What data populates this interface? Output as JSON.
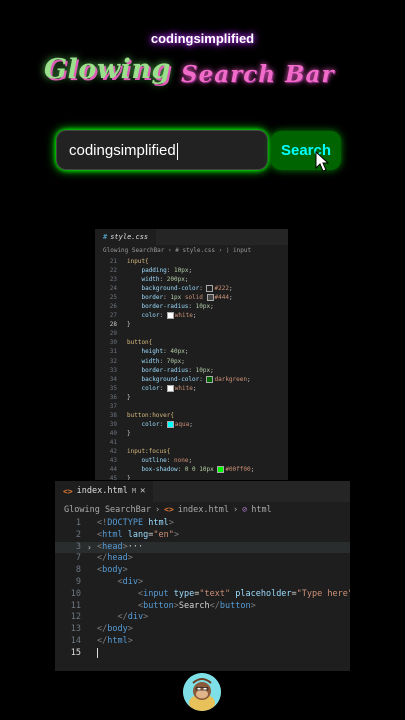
{
  "header": {
    "channel": "codingsimplified",
    "title_part1": "Glowing",
    "title_part2": "Search Bar"
  },
  "demo": {
    "input_value": "codingsimplified",
    "button_label": "Search"
  },
  "css_editor": {
    "tab": "style.css",
    "breadcrumb": "Glowing SearchBar › # style.css › ⟩ input",
    "lines": [
      {
        "n": "21",
        "segs": [
          [
            "input{",
            "sel"
          ]
        ]
      },
      {
        "n": "22",
        "segs": [
          [
            "    ",
            ""
          ],
          [
            "padding",
            "prop"
          ],
          [
            ": ",
            "punc"
          ],
          [
            "10px",
            "num"
          ],
          [
            ";",
            "punc"
          ]
        ]
      },
      {
        "n": "23",
        "segs": [
          [
            "    ",
            ""
          ],
          [
            "width",
            "prop"
          ],
          [
            ": ",
            "punc"
          ],
          [
            "200px",
            "num"
          ],
          [
            ";",
            "punc"
          ]
        ]
      },
      {
        "n": "24",
        "segs": [
          [
            "    ",
            ""
          ],
          [
            "background-color",
            "prop"
          ],
          [
            ": ",
            "punc"
          ],
          [
            "sw:#222",
            ""
          ],
          [
            "#222",
            "val"
          ],
          [
            ";",
            "punc"
          ]
        ]
      },
      {
        "n": "25",
        "segs": [
          [
            "    ",
            ""
          ],
          [
            "border",
            "prop"
          ],
          [
            ": ",
            "punc"
          ],
          [
            "1px ",
            "num"
          ],
          [
            "solid ",
            "val"
          ],
          [
            "sw:#444",
            ""
          ],
          [
            "#444",
            "val"
          ],
          [
            ";",
            "punc"
          ]
        ]
      },
      {
        "n": "26",
        "segs": [
          [
            "    ",
            ""
          ],
          [
            "border-radius",
            "prop"
          ],
          [
            ": ",
            "punc"
          ],
          [
            "10px",
            "num"
          ],
          [
            ";",
            "punc"
          ]
        ]
      },
      {
        "n": "27",
        "segs": [
          [
            "    ",
            ""
          ],
          [
            "color",
            "prop"
          ],
          [
            ": ",
            "punc"
          ],
          [
            "sw:#ffffff",
            ""
          ],
          [
            "white",
            "val"
          ],
          [
            ";",
            "punc"
          ]
        ]
      },
      {
        "n": "28",
        "segs": [
          [
            "}",
            "punc"
          ]
        ]
      },
      {
        "n": "29",
        "segs": []
      },
      {
        "n": "30",
        "segs": [
          [
            "button{",
            "sel"
          ]
        ]
      },
      {
        "n": "31",
        "segs": [
          [
            "    ",
            ""
          ],
          [
            "height",
            "prop"
          ],
          [
            ": ",
            "punc"
          ],
          [
            "40px",
            "num"
          ],
          [
            ";",
            "punc"
          ]
        ]
      },
      {
        "n": "32",
        "segs": [
          [
            "    ",
            ""
          ],
          [
            "width",
            "prop"
          ],
          [
            ": ",
            "punc"
          ],
          [
            "70px",
            "num"
          ],
          [
            ";",
            "punc"
          ]
        ]
      },
      {
        "n": "33",
        "segs": [
          [
            "    ",
            ""
          ],
          [
            "border-radius",
            "prop"
          ],
          [
            ": ",
            "punc"
          ],
          [
            "10px",
            "num"
          ],
          [
            ";",
            "punc"
          ]
        ]
      },
      {
        "n": "34",
        "segs": [
          [
            "    ",
            ""
          ],
          [
            "background-color",
            "prop"
          ],
          [
            ": ",
            "punc"
          ],
          [
            "sw:#006400",
            ""
          ],
          [
            "darkgreen",
            "val"
          ],
          [
            ";",
            "punc"
          ]
        ]
      },
      {
        "n": "35",
        "segs": [
          [
            "    ",
            ""
          ],
          [
            "color",
            "prop"
          ],
          [
            ": ",
            "punc"
          ],
          [
            "sw:#ffffff",
            ""
          ],
          [
            "white",
            "val"
          ],
          [
            ";",
            "punc"
          ]
        ]
      },
      {
        "n": "36",
        "segs": [
          [
            "}",
            "punc"
          ]
        ]
      },
      {
        "n": "37",
        "segs": []
      },
      {
        "n": "38",
        "segs": [
          [
            "button:hover{",
            "sel"
          ]
        ]
      },
      {
        "n": "39",
        "segs": [
          [
            "    ",
            ""
          ],
          [
            "color",
            "prop"
          ],
          [
            ": ",
            "punc"
          ],
          [
            "sw:#00ffff",
            ""
          ],
          [
            "aqua",
            "val"
          ],
          [
            ";",
            "punc"
          ]
        ]
      },
      {
        "n": "40",
        "segs": [
          [
            "}",
            "punc"
          ]
        ]
      },
      {
        "n": "41",
        "segs": []
      },
      {
        "n": "42",
        "segs": [
          [
            "input:focus{",
            "sel"
          ]
        ]
      },
      {
        "n": "43",
        "segs": [
          [
            "    ",
            ""
          ],
          [
            "outline",
            "prop"
          ],
          [
            ": ",
            "punc"
          ],
          [
            "none",
            "val"
          ],
          [
            ";",
            "punc"
          ]
        ]
      },
      {
        "n": "44",
        "segs": [
          [
            "    ",
            ""
          ],
          [
            "box-shadow",
            "prop"
          ],
          [
            ": ",
            "punc"
          ],
          [
            "0 0 10px ",
            "num"
          ],
          [
            "sw:#00ff00",
            ""
          ],
          [
            "#00ff00",
            "val"
          ],
          [
            ";",
            "punc"
          ]
        ]
      },
      {
        "n": "45",
        "segs": [
          [
            "}",
            "punc"
          ]
        ]
      },
      {
        "n": "46",
        "segs": []
      }
    ],
    "active_line": "28"
  },
  "html_editor": {
    "tab": "index.html",
    "tab_badge": "M",
    "breadcrumb_root": "Glowing SearchBar",
    "breadcrumb_file": "index.html",
    "breadcrumb_node": "html",
    "lines": [
      {
        "n": "1",
        "html": "<span class='br'>&lt;!</span><span class='tag'>DOCTYPE</span> <span class='attr'>html</span><span class='br'>&gt;</span>"
      },
      {
        "n": "2",
        "html": "<span class='br'>&lt;</span><span class='tag'>html</span> <span class='attr'>lang</span><span class='txt'>=</span><span class='str'>\"en\"</span><span class='br'>&gt;</span>"
      },
      {
        "n": "3",
        "html": "<span class='br'>&lt;</span><span class='tag'>head</span><span class='br'>&gt;</span><span class='txt'>···</span>",
        "fold": true,
        "hl": true
      },
      {
        "n": "7",
        "html": "<span class='br'>&lt;/</span><span class='tag'>head</span><span class='br'>&gt;</span>"
      },
      {
        "n": "8",
        "html": "<span class='br'>&lt;</span><span class='tag'>body</span><span class='br'>&gt;</span>"
      },
      {
        "n": "9",
        "html": "    <span class='br'>&lt;</span><span class='tag'>div</span><span class='br'>&gt;</span>"
      },
      {
        "n": "10",
        "html": "        <span class='br'>&lt;</span><span class='tag'>input</span> <span class='attr'>type</span><span class='txt'>=</span><span class='str'>\"text\"</span> <span class='attr'>placeholder</span><span class='txt'>=</span><span class='str'>\"Type here\"</span><span class='br'>&gt;</span>"
      },
      {
        "n": "11",
        "html": "        <span class='br'>&lt;</span><span class='tag'>button</span><span class='br'>&gt;</span><span class='txt'>Search</span><span class='br'>&lt;/</span><span class='tag'>button</span><span class='br'>&gt;</span>"
      },
      {
        "n": "12",
        "html": "    <span class='br'>&lt;/</span><span class='tag'>div</span><span class='br'>&gt;</span>"
      },
      {
        "n": "13",
        "html": "<span class='br'>&lt;/</span><span class='tag'>body</span><span class='br'>&gt;</span>"
      },
      {
        "n": "14",
        "html": "<span class='br'>&lt;/</span><span class='tag'>html</span><span class='br'>&gt;</span>"
      },
      {
        "n": "15",
        "html": ""
      }
    ],
    "active_line": "15"
  },
  "colors": {
    "glow": "#00ff00",
    "button_bg": "#006400",
    "button_text": "#00ffff",
    "input_bg": "#222222"
  }
}
